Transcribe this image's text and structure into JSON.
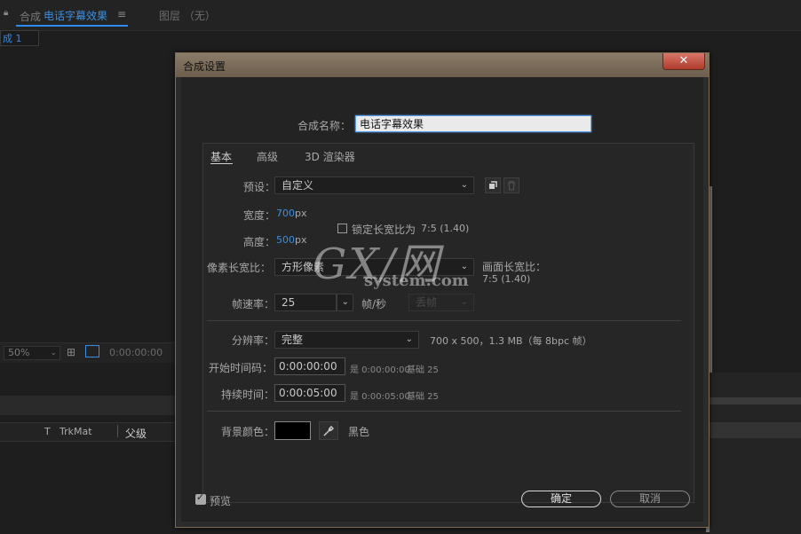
{
  "app": {
    "panel_tab_comp_prefix": "合成",
    "panel_tab_comp_name": "电话字幕效果",
    "panel_tab_layer": "图层 （无）",
    "comp_subtab": "成 1",
    "zoom": "50%",
    "timecode": "0:00:00:00",
    "col_t": "T",
    "col_trkmat": "TrkMat",
    "col_parent": "父级"
  },
  "dialog": {
    "title": "合成设置",
    "close_glyph": "✕",
    "name_label": "合成名称：",
    "name_value": "电话字幕效果",
    "tabs": [
      {
        "label": "基本",
        "active": true
      },
      {
        "label": "高级",
        "active": false
      },
      {
        "label": "3D 渲染器",
        "active": false
      }
    ],
    "preset_label": "预设：",
    "preset_value": "自定义",
    "width_label": "宽度：",
    "width_value": "700",
    "height_label": "高度：",
    "height_value": "500",
    "px": "px",
    "lock_aspect_label": "锁定长宽比为",
    "lock_aspect_value": "7:5 (1.40)",
    "pixel_aspect_label": "像素长宽比：",
    "pixel_aspect_value": "方形像素",
    "frame_aspect_label": "画面长宽比：",
    "frame_aspect_value": "7:5 (1.40)",
    "framerate_label": "帧速率：",
    "framerate_value": "25",
    "framerate_unit": "帧/秒",
    "drop_frame_value": "丢帧",
    "resolution_label": "分辨率：",
    "resolution_value": "完整",
    "resolution_info": "700 x 500，1.3 MB（每 8bpc 帧）",
    "start_tc_label": "开始时间码：",
    "start_tc_value": "0:00:00:00",
    "start_tc_info": "是 0:00:00:00",
    "start_tc_base": "基础 25",
    "duration_label": "持续时间：",
    "duration_value": "0:00:05:00",
    "duration_info": "是 0:00:05:00",
    "duration_base": "基础 25",
    "bg_color_label": "背景颜色：",
    "bg_color_name": "黑色",
    "bg_color_hex": "#000000",
    "preview_label": "预览",
    "ok_label": "确定",
    "cancel_label": "取消"
  },
  "watermark": {
    "logo": "GX/网",
    "domain": "system.com"
  },
  "icons": {
    "save_preset": "save-preset-icon",
    "delete_preset": "trash-icon",
    "eyedropper": "eyedropper-icon",
    "lock": "lock-icon"
  },
  "colors": {
    "accent_blue": "#2d8ceb",
    "dialog_title": "#7a6c58",
    "close_red": "#c04a3a"
  }
}
